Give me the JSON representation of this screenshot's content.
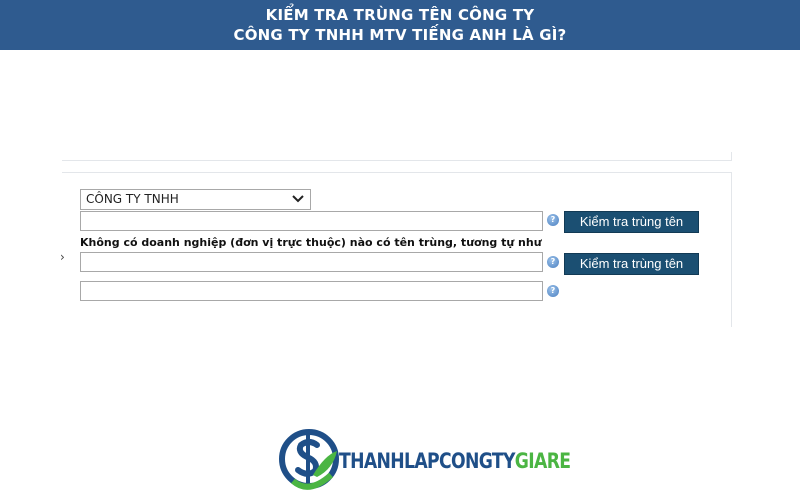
{
  "banner": {
    "line1": "KIỂM TRA TRÙNG TÊN CÔNG TY",
    "line2": "CÔNG TY TNHH MTV TIẾNG ANH LÀ GÌ?"
  },
  "form": {
    "company_type_select": {
      "selected": "CÔNG TY TNHH"
    },
    "name_input_1": {
      "value": ""
    },
    "name_input_2": {
      "value": ""
    },
    "name_input_3": {
      "value": ""
    },
    "check_button_label": "Kiểm tra trùng tên",
    "result_message": "Không có doanh nghiệp (đơn vị trực thuộc) nào có tên trùng, tương tự như",
    "help_glyph": "?"
  },
  "logo": {
    "text_part1": "THANHLAPCONGTY",
    "text_part2": "GIARE"
  },
  "colors": {
    "banner_bg": "#2f5b8f",
    "button_bg": "#1b4f72",
    "logo_blue": "#1f4f88",
    "logo_green": "#4bb543"
  }
}
